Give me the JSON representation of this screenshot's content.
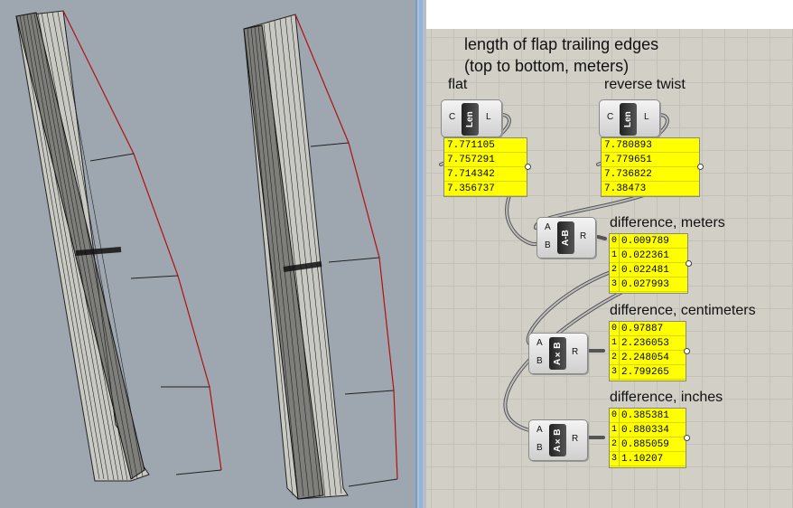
{
  "annotation": {
    "title_line1": "length of flap trailing edges",
    "title_line2": "(top to bottom, meters)"
  },
  "groups": {
    "flat": {
      "label": "flat",
      "component": "Len",
      "inputs": [
        "C"
      ],
      "outputs": [
        "L"
      ],
      "values": [
        "7.771105",
        "7.757291",
        "7.714342",
        "7.356737"
      ]
    },
    "reverse_twist": {
      "label": "reverse twist",
      "component": "Len",
      "inputs": [
        "C"
      ],
      "outputs": [
        "L"
      ],
      "values": [
        "7.780893",
        "7.779651",
        "7.736822",
        "7.38473"
      ]
    }
  },
  "subtract": {
    "component": "A-B",
    "inputs": [
      "A",
      "B"
    ],
    "output": "R",
    "label": "difference, meters",
    "indices": [
      "0",
      "1",
      "2",
      "3"
    ],
    "values": [
      "0.009789",
      "0.022361",
      "0.022481",
      "0.027993"
    ]
  },
  "mult_cm": {
    "component": "A×B",
    "inputs": [
      "A",
      "B"
    ],
    "output": "R",
    "label": "difference, centimeters",
    "indices": [
      "0",
      "1",
      "2",
      "3"
    ],
    "values": [
      "0.97887",
      "2.236053",
      "2.248054",
      "2.799265"
    ]
  },
  "mult_in": {
    "component": "A×B",
    "inputs": [
      "A",
      "B"
    ],
    "output": "R",
    "label": "difference, inches",
    "indices": [
      "0",
      "1",
      "2",
      "3"
    ],
    "values": [
      "0.385381",
      "0.880334",
      "0.885059",
      "1.10207"
    ]
  },
  "colors": {
    "viewport_bg": "#9ea7b0",
    "panel_yellow": "#ffff00",
    "trailing_edge": "#b01010",
    "canvas_bg": "#d2cfc6"
  }
}
